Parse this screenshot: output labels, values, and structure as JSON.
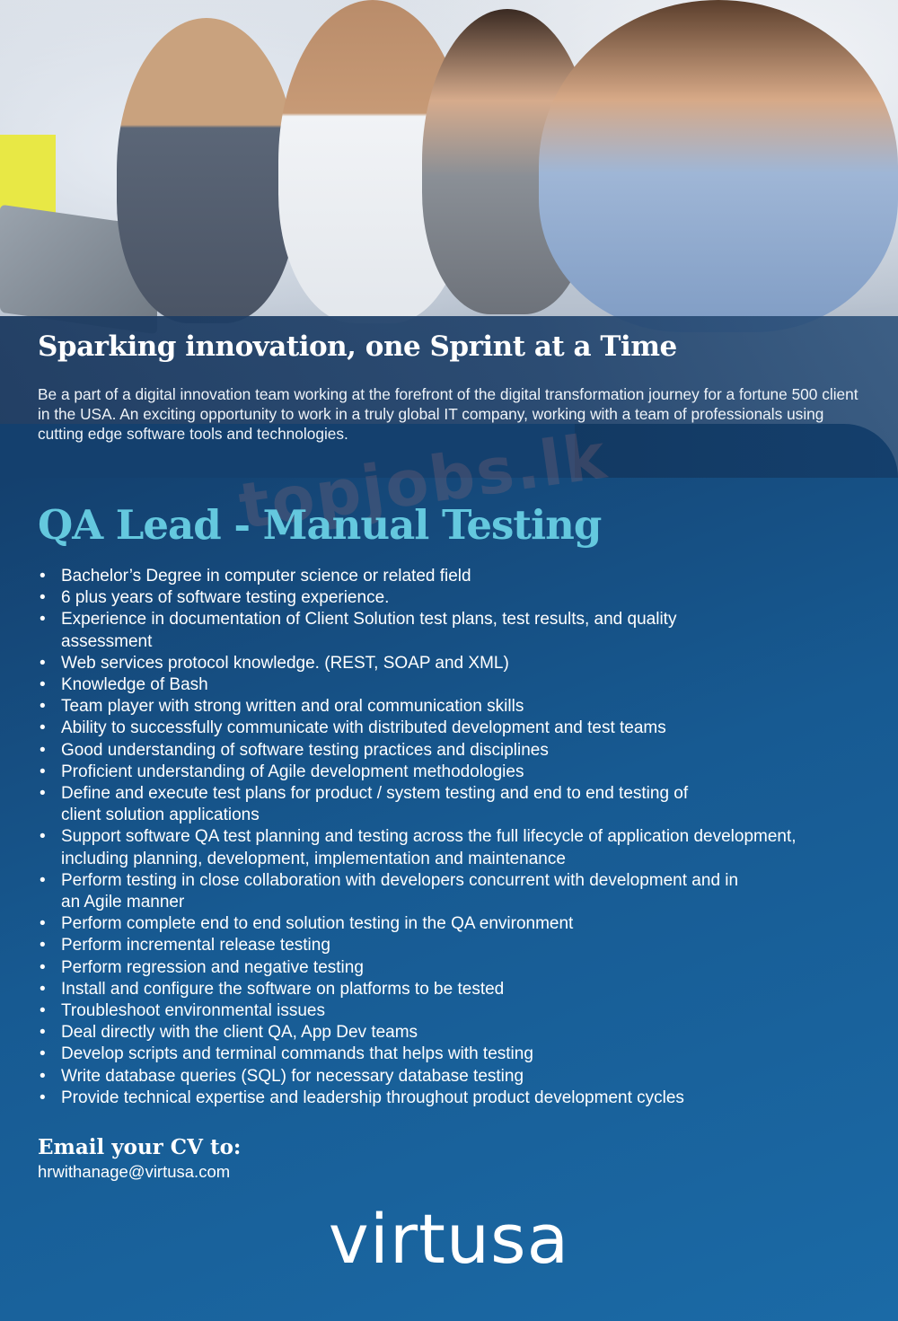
{
  "intro": {
    "title": "Sparking innovation, one Sprint at a Time",
    "text": "Be a part of a digital innovation team working at the forefront of the digital transformation journey for a fortune 500 client in the USA. An exciting opportunity to work in a truly global IT company, working with a team of professionals using cutting edge software tools and technologies."
  },
  "watermark": "topjobs.lk",
  "job": {
    "title": "QA Lead - Manual Testing",
    "requirements": [
      "Bachelor’s Degree in computer science or related field",
      "6 plus years of software testing experience.",
      "Experience in documentation of Client Solution test plans, test results, and quality assessment",
      "Web services protocol knowledge. (REST, SOAP and XML)",
      "Knowledge of Bash",
      "Team player with strong written and oral communication skills",
      "Ability to successfully communicate with distributed development and test teams",
      "Good understanding of software testing practices and disciplines",
      "Proficient understanding of Agile development methodologies",
      "Define and execute test plans for product / system testing and end to end testing of client solution applications",
      "Support software QA test planning and testing across the full lifecycle of application development, including planning, development, implementation and maintenance",
      "Perform testing in close collaboration with developers concurrent with development and in an Agile manner",
      "Perform complete end to end solution testing in the QA environment",
      "Perform incremental release testing",
      "Perform regression and negative testing",
      "Install and configure the software on platforms to be tested",
      "Troubleshoot environmental issues",
      "Deal directly with the client QA, App Dev teams",
      "Develop scripts and terminal commands that helps with testing",
      "Write database queries (SQL) for necessary database testing",
      "Provide technical expertise and leadership throughout product development cycles"
    ]
  },
  "contact": {
    "label": "Email your CV to:",
    "email": "hrwithanage@virtusa.com"
  },
  "logo": "virtusa",
  "colors": {
    "accent": "#64c8de",
    "panel": "#175a92"
  }
}
